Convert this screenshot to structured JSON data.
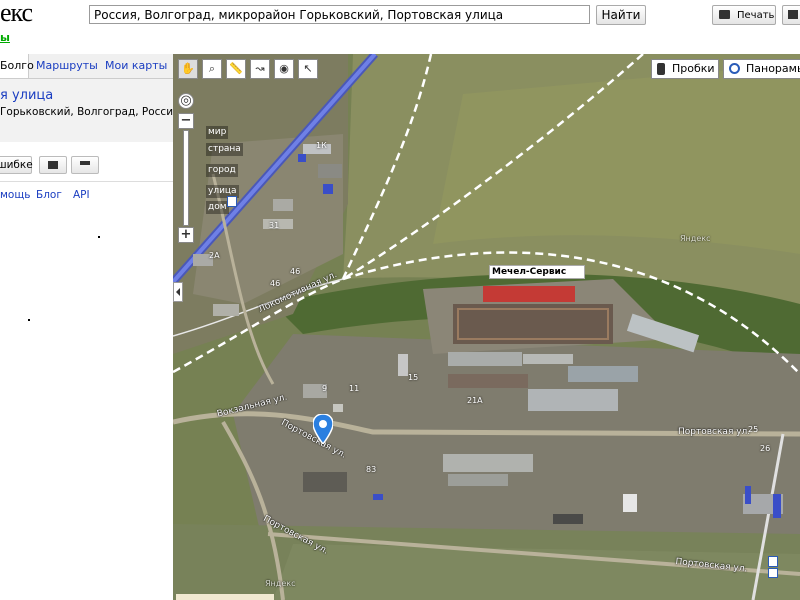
{
  "header": {
    "logo": "екс",
    "logo_sub": "ы",
    "search_value": "Россия, Волгоград, микрорайон Горьковский, Портовская улица",
    "find_label": "Найти",
    "print_label": "Печать",
    "print_icon": "printer-icon",
    "port_icon": "print-alt-icon"
  },
  "sidebar": {
    "tabs": [
      {
        "label": "Болго"
      },
      {
        "label": "Маршруты"
      },
      {
        "label": "Мои карты"
      }
    ],
    "result_title": "я улица",
    "result_sub": "Горьковский, Волгоград, Россия",
    "error_label": "шибке",
    "footer_links": [
      "мощь",
      "Блог",
      "API"
    ]
  },
  "map": {
    "tools": [
      "hand-icon",
      "magnifier-icon",
      "ruler-icon",
      "route-icon",
      "camera-icon",
      "cursor-icon"
    ],
    "zoom_labels": [
      "мир",
      "страна",
      "город",
      "улица",
      "дом"
    ],
    "traffic_label": "Пробки",
    "panorama_label": "Панорамы",
    "poi_name": "Мечел-Сервис",
    "street_labels": {
      "lokomotivnaya": "Локомотивная ул.",
      "vokzalnaya": "Вокзальная ул.",
      "portovskaya_1": "Портовская ул.",
      "portovskaya_2": "Портовская ул.",
      "portovskaya_3": "Портовская ул.",
      "portovskaya_4": "Портовская ул."
    },
    "watermarks": [
      "Яндекс",
      "Яндекс"
    ],
    "house_numbers": [
      "1К",
      "31",
      "2А",
      "46",
      "46",
      "9",
      "11",
      "15",
      "21А",
      "25",
      "26",
      "83"
    ],
    "colors": {
      "road_blue": "#5a6fd6",
      "roof_red": "#c43a35",
      "railway": "#ffffff"
    }
  }
}
